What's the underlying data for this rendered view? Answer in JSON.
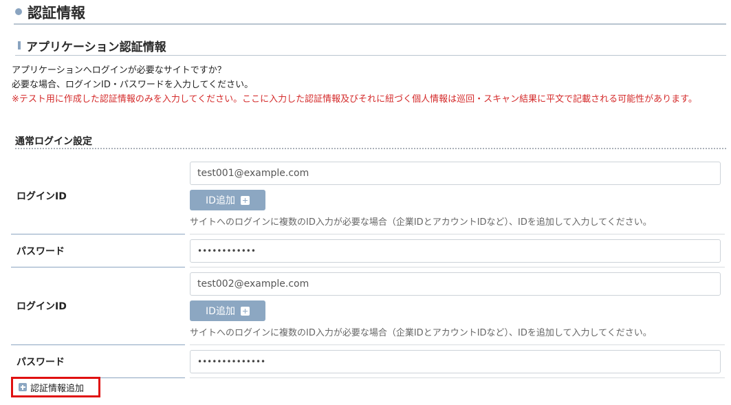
{
  "section": {
    "title": "認証情報"
  },
  "subsection": {
    "title": "アプリケーション認証情報"
  },
  "description": {
    "line1": "アプリケーションへログインが必要なサイトですか？",
    "line2": "必要な場合、ログインID・パスワードを入力してください。",
    "warning": "※テスト用に作成した認証情報のみを入力してください。ここに入力した認証情報及びそれに紐づく個人情報は巡回・スキャン結果に平文で記載される可能性があります。"
  },
  "group": {
    "title": "通常ログイン設定"
  },
  "credentials": [
    {
      "login_label": "ログインID",
      "login_value": "test001@example.com",
      "id_add_label": "ID追加",
      "hint": "サイトへのログインに複数のID入力が必要な場合（企業IDとアカウントIDなど）、IDを追加して入力してください。",
      "password_label": "パスワード",
      "password_value": "••••••••••••"
    },
    {
      "login_label": "ログインID",
      "login_value": "test002@example.com",
      "id_add_label": "ID追加",
      "hint": "サイトへのログインに複数のID入力が必要な場合（企業IDとアカウントIDなど）、IDを追加して入力してください。",
      "password_label": "パスワード",
      "password_value": "••••••••••••••"
    }
  ],
  "add_auth_label": "認証情報追加",
  "colors": {
    "accent": "#8ca7c2",
    "warning": "#d42a2a",
    "highlight": "#e01010"
  }
}
